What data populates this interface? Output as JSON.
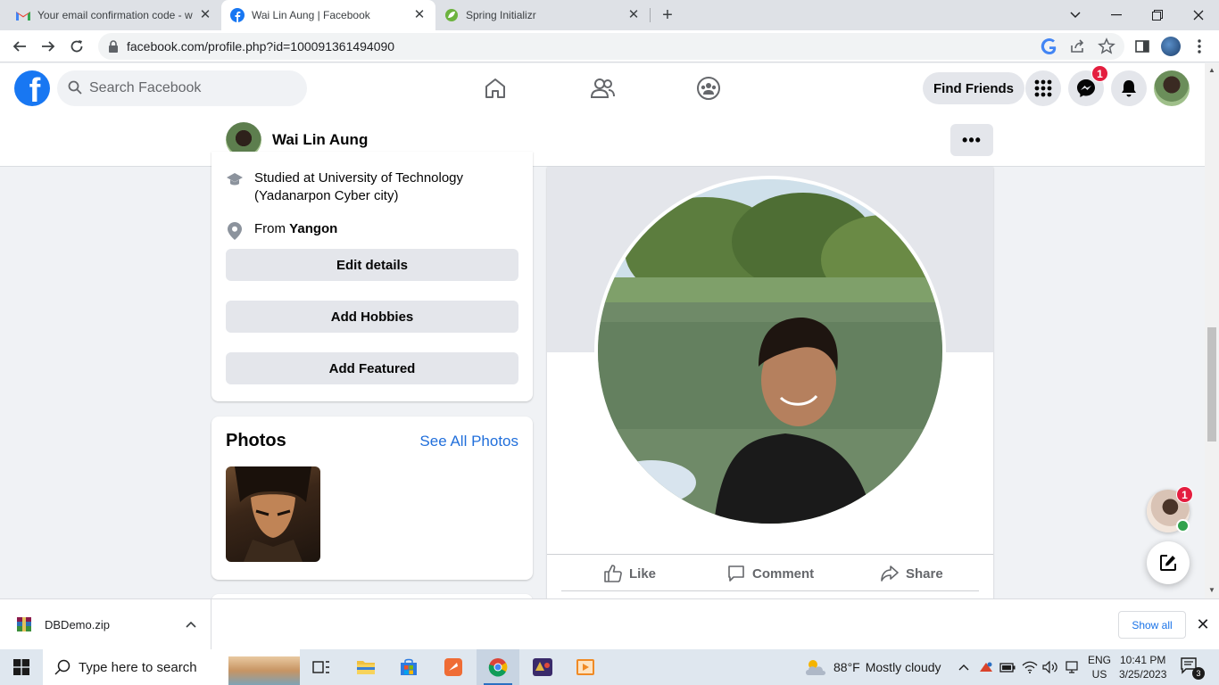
{
  "browser": {
    "tabs": [
      {
        "title": "Your email confirmation code - w",
        "icon": "gmail-icon"
      },
      {
        "title": "Wai Lin Aung | Facebook",
        "icon": "facebook-icon"
      },
      {
        "title": "Spring Initializr",
        "icon": "spring-icon"
      }
    ],
    "url": "facebook.com/profile.php?id=100091361494090"
  },
  "fb": {
    "search_placeholder": "Search Facebook",
    "find_friends": "Find Friends",
    "messenger_badge": "1",
    "brand_color": "#1877f2"
  },
  "profile": {
    "name": "Wai Lin Aung",
    "more": "•••"
  },
  "intro": {
    "studied": "Studied at University of Technology (Yadanarpon Cyber city)",
    "from_prefix": "From ",
    "from_place": "Yangon",
    "buttons": [
      "Edit details",
      "Add Hobbies",
      "Add Featured"
    ]
  },
  "photos": {
    "title": "Photos",
    "see_all": "See All Photos"
  },
  "post": {
    "actions": [
      "Like",
      "Comment",
      "Share"
    ]
  },
  "chat": {
    "badge": "1"
  },
  "download": {
    "filename": "DBDemo.zip",
    "show_all": "Show all"
  },
  "taskbar": {
    "search_placeholder": "Type here to search",
    "weather_temp": "88°F",
    "weather_desc": "Mostly cloudy",
    "lang_top": "ENG",
    "lang_bottom": "US",
    "time": "10:41 PM",
    "date": "3/25/2023",
    "notif_count": "3"
  }
}
